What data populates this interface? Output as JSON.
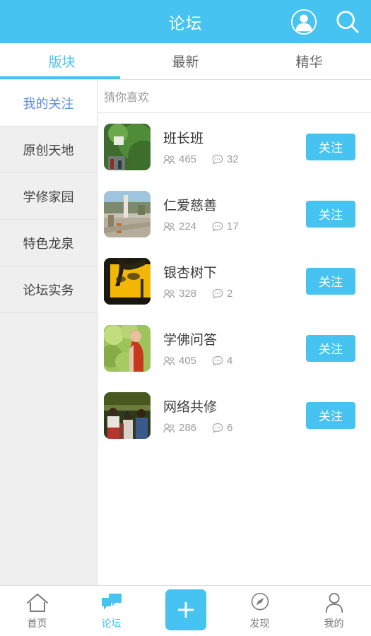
{
  "header": {
    "title": "论坛",
    "accent_color": "#46c3f0",
    "avatar_icon": "user-circle-icon",
    "search_icon": "search-icon"
  },
  "tabs": [
    {
      "label": "版块",
      "active": true
    },
    {
      "label": "最新",
      "active": false
    },
    {
      "label": "精华",
      "active": false
    }
  ],
  "sidebar": {
    "items": [
      {
        "label": "我的关注",
        "selected": true
      },
      {
        "label": "原创天地",
        "selected": false
      },
      {
        "label": "学修家园",
        "selected": false
      },
      {
        "label": "特色龙泉",
        "selected": false
      },
      {
        "label": "论坛实务",
        "selected": false
      }
    ]
  },
  "list": {
    "section_title": "猜你喜欢",
    "follow_label": "关注",
    "members_icon": "members-icon",
    "comments_icon": "comment-bubble-icon",
    "rows": [
      {
        "title": "班长班",
        "members": "465",
        "comments": "32",
        "thumb": "garden-green-thumbnail"
      },
      {
        "title": "仁爱慈善",
        "members": "224",
        "comments": "17",
        "thumb": "courtyard-thumbnail"
      },
      {
        "title": "银杏树下",
        "members": "328",
        "comments": "2",
        "thumb": "ginkgo-yellow-thumbnail"
      },
      {
        "title": "学佛问答",
        "members": "405",
        "comments": "4",
        "thumb": "monk-red-robe-thumbnail"
      },
      {
        "title": "网络共修",
        "members": "286",
        "comments": "6",
        "thumb": "group-people-thumbnail"
      }
    ]
  },
  "bottom_nav": {
    "items": [
      {
        "label": "首页",
        "icon": "home-icon",
        "active": false
      },
      {
        "label": "论坛",
        "icon": "forum-bubbles-icon",
        "active": true
      },
      {
        "label": "",
        "icon": "plus-icon",
        "active": false
      },
      {
        "label": "发现",
        "icon": "compass-icon",
        "active": false
      },
      {
        "label": "我的",
        "icon": "person-icon",
        "active": false
      }
    ]
  }
}
